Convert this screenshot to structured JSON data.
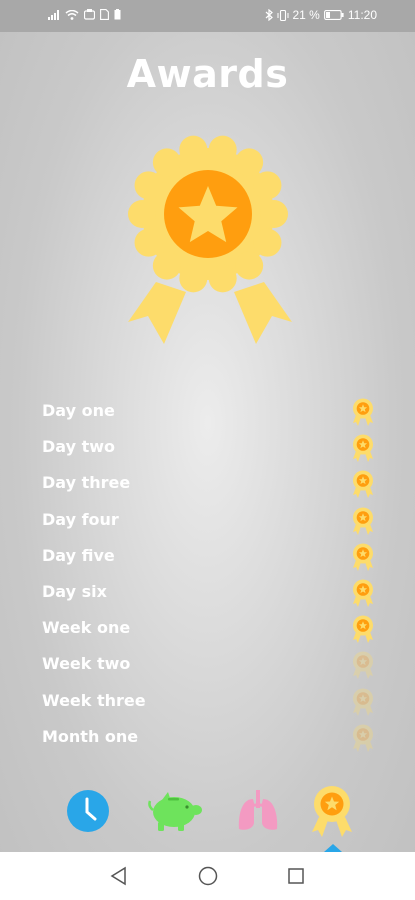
{
  "status_bar": {
    "battery_percent": "21 %",
    "time": "11:20",
    "left_icons": [
      "signal-icon",
      "wifi-icon",
      "notification-icon",
      "sim-icon",
      "charging-icon"
    ],
    "right_icons": [
      "bluetooth-icon",
      "vibrate-icon",
      "battery-icon"
    ]
  },
  "page": {
    "title": "Awards"
  },
  "awards": [
    {
      "label": "Day one",
      "unlocked": true
    },
    {
      "label": "Day two",
      "unlocked": true
    },
    {
      "label": "Day three",
      "unlocked": true
    },
    {
      "label": "Day four",
      "unlocked": true
    },
    {
      "label": "Day five",
      "unlocked": true
    },
    {
      "label": "Day six",
      "unlocked": true
    },
    {
      "label": "Week one",
      "unlocked": true
    },
    {
      "label": "Week two",
      "unlocked": false
    },
    {
      "label": "Week three",
      "unlocked": false
    },
    {
      "label": "Month one",
      "unlocked": false
    }
  ],
  "bottom_nav": {
    "items": [
      {
        "icon": "clock-icon",
        "color": "#29a6e8"
      },
      {
        "icon": "piggy-bank-icon",
        "color": "#6ee35c"
      },
      {
        "icon": "lungs-icon",
        "color": "#f39ac2"
      },
      {
        "icon": "award-medal-icon",
        "color": "#fddc6b",
        "active": true
      }
    ]
  },
  "colors": {
    "medal_ribbon": "#fddc6b",
    "medal_core": "#ff9e0f",
    "medal_star": "#fddc6b",
    "status_bar_bg": "#a8a8a8",
    "active_indicator": "#29a6e8"
  },
  "system_nav": {
    "icons": [
      "back-icon",
      "home-icon",
      "recents-icon"
    ]
  }
}
